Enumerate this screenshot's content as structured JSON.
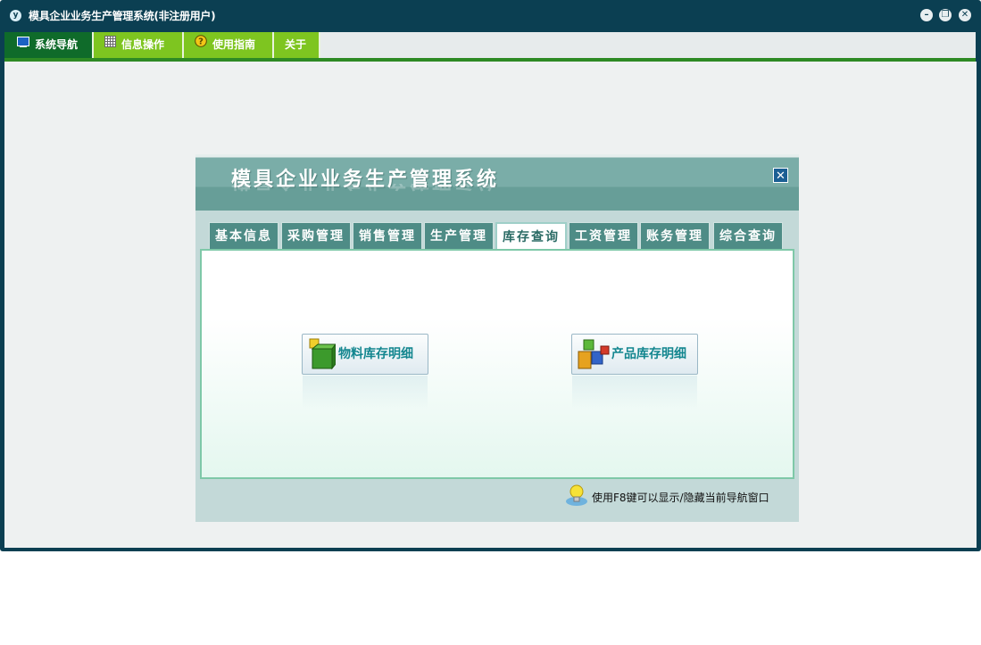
{
  "window": {
    "title": "模具企业业务生产管理系统(非注册用户)",
    "icon": "app-logo-icon"
  },
  "menubar": {
    "items": [
      {
        "label": "系统导航",
        "icon": "monitor-icon",
        "active": true
      },
      {
        "label": "信息操作",
        "icon": "grid-icon",
        "active": false
      },
      {
        "label": "使用指南",
        "icon": "help-icon",
        "active": false
      },
      {
        "label": "关于",
        "icon": "",
        "active": false
      }
    ]
  },
  "panel": {
    "title": "模具企业业务生产管理系统",
    "tabs": [
      {
        "label": "基本信息",
        "active": false
      },
      {
        "label": "采购管理",
        "active": false
      },
      {
        "label": "销售管理",
        "active": false
      },
      {
        "label": "生产管理",
        "active": false
      },
      {
        "label": "库存查询",
        "active": true
      },
      {
        "label": "工资管理",
        "active": false
      },
      {
        "label": "账务管理",
        "active": false
      },
      {
        "label": "综合查询",
        "active": false
      }
    ],
    "buttons": [
      {
        "label": "物料库存明细",
        "icon": "material-cubes-icon"
      },
      {
        "label": "产品库存明细",
        "icon": "product-boxes-icon"
      }
    ],
    "hint": "使用F8键可以显示/隐藏当前导航窗口"
  },
  "colors": {
    "window_frame": "#0b3f52",
    "menu_green": "#7ec520",
    "menu_active": "#0f6b2a",
    "tab_teal": "#4e8c86",
    "button_text": "#13868f"
  }
}
